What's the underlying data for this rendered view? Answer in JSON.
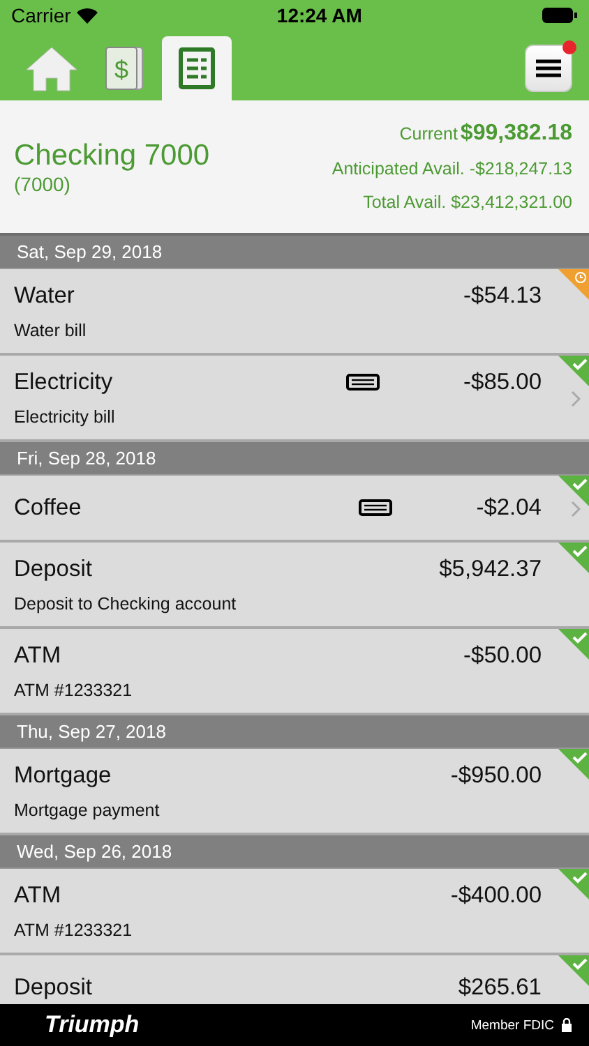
{
  "status_bar": {
    "carrier": "Carrier",
    "time": "12:24 AM"
  },
  "tabs": [
    {
      "kind": "home",
      "selected": false
    },
    {
      "kind": "money",
      "symbol": "$",
      "selected": false
    },
    {
      "kind": "ledger",
      "selected": true
    }
  ],
  "menu": {
    "notification": true
  },
  "account": {
    "name": "Checking 7000",
    "number": "(7000)",
    "current_label": "Current",
    "current": "$99,382.18",
    "anticipated": "Anticipated Avail. -$218,247.13",
    "total": "Total Avail. $23,412,321.00"
  },
  "groups": [
    {
      "date": "Sat, Sep 29, 2018",
      "transactions": [
        {
          "title": "Water",
          "amount": "-$54.13",
          "memo": "Water bill",
          "cleared": false,
          "attachment": false,
          "chevron": false
        },
        {
          "title": "Electricity",
          "amount": "-$85.00",
          "memo": "Electricity bill",
          "cleared": true,
          "attachment": true,
          "chevron": true
        }
      ]
    },
    {
      "date": "Fri, Sep 28, 2018",
      "transactions": [
        {
          "title": "Coffee",
          "amount": "-$2.04",
          "cleared": true,
          "attachment": true,
          "chevron": true
        },
        {
          "title": "Deposit",
          "amount": "$5,942.37",
          "memo": "Deposit to Checking account",
          "cleared": true,
          "attachment": false,
          "chevron": false
        },
        {
          "title": "ATM",
          "amount": "-$50.00",
          "memo": "ATM #1233321",
          "cleared": true,
          "attachment": false,
          "chevron": false
        }
      ]
    },
    {
      "date": "Thu, Sep 27, 2018",
      "transactions": [
        {
          "title": "Mortgage",
          "amount": "-$950.00",
          "memo": "Mortgage payment",
          "cleared": true,
          "attachment": false,
          "chevron": false
        }
      ]
    },
    {
      "date": "Wed, Sep 26, 2018",
      "transactions": [
        {
          "title": "ATM",
          "amount": "-$400.00",
          "memo": "ATM #1233321",
          "cleared": true,
          "attachment": false,
          "chevron": false
        },
        {
          "title": "Deposit",
          "amount": "$265.61",
          "cleared": true,
          "attachment": false,
          "chevron": false
        }
      ]
    }
  ],
  "footer": {
    "brand": "Triumph",
    "fdic": "Member FDIC"
  }
}
